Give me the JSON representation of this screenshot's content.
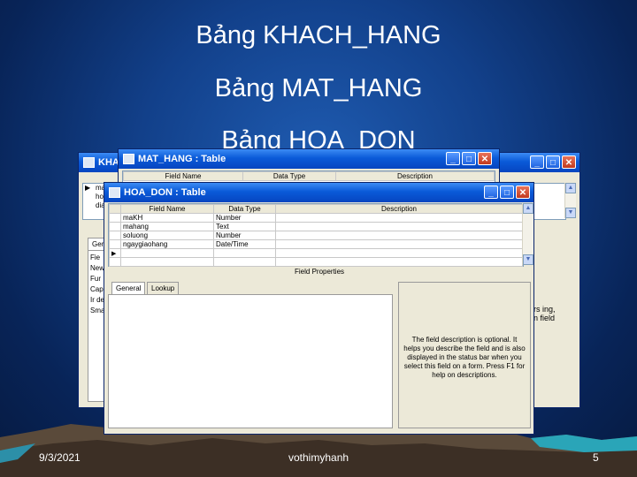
{
  "slide": {
    "titles": [
      "Bảng KHACH_HANG",
      "Bảng MAT_HANG",
      "Bảng HOA_DON"
    ],
    "footer": {
      "date": "9/3/2021",
      "author": "vothimyhanh",
      "page": "5"
    }
  },
  "windows": {
    "khach_hang": {
      "title": "KHA",
      "left_labels": [
        "Fie",
        "New",
        "Fur",
        "Cap",
        "Ir de",
        "Sma"
      ],
      "row_labels": [
        "ma",
        "ho",
        "dia"
      ],
      "tab_label": "Gen",
      "help_fragment": [
        "rs ing,",
        "n field"
      ]
    },
    "mat_hang": {
      "title": "MAT_HANG : Table",
      "columns": [
        "Field Name",
        "Data Type",
        "Description"
      ]
    },
    "hoa_don": {
      "title": "HOA_DON : Table",
      "columns": [
        "Field Name",
        "Data Type",
        "Description"
      ],
      "rows": [
        {
          "field": "maKH",
          "type": "Number"
        },
        {
          "field": "mahang",
          "type": "Text"
        },
        {
          "field": "soluong",
          "type": "Number"
        },
        {
          "field": "ngaygiaohang",
          "type": "Date/Time"
        }
      ],
      "field_properties_label": "Field Properties",
      "tabs": [
        "General",
        "Lookup"
      ],
      "help_text": "The field description is optional. It helps you describe the field and is also displayed in the status bar when you select this field on a form. Press F1 for help on descriptions."
    }
  },
  "colors": {
    "background": "#0b2f6e",
    "titlebar": "#0a5ad8",
    "window": "#ece9d8"
  },
  "icons": [
    "minimize-icon",
    "maximize-icon",
    "close-icon",
    "table-icon",
    "scroll-up-icon",
    "scroll-down-icon",
    "row-selector-icon"
  ]
}
